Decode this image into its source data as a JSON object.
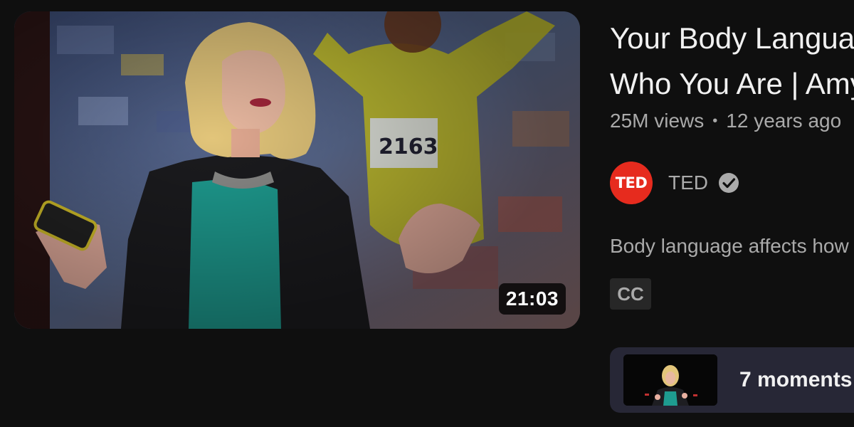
{
  "video": {
    "title_line1": "Your Body Language May Shape",
    "title_line2": "Who You Are | Amy Cuddy",
    "views": "25M views",
    "separator": "•",
    "age": "12 years ago",
    "duration": "21:03",
    "description": "Body language affects how others see us",
    "cc_label": "CC"
  },
  "channel": {
    "name": "TED",
    "avatar_text": "TED",
    "avatar_color": "#e62b1e",
    "verified_icon": "verified-check-icon"
  },
  "moments": {
    "label": "7 moments"
  },
  "colors": {
    "background": "#0f0f0f",
    "primary_text": "#f1f1f1",
    "secondary_text": "#aaaaaa",
    "chip_bg": "#272727",
    "moments_bg": "#272736"
  }
}
